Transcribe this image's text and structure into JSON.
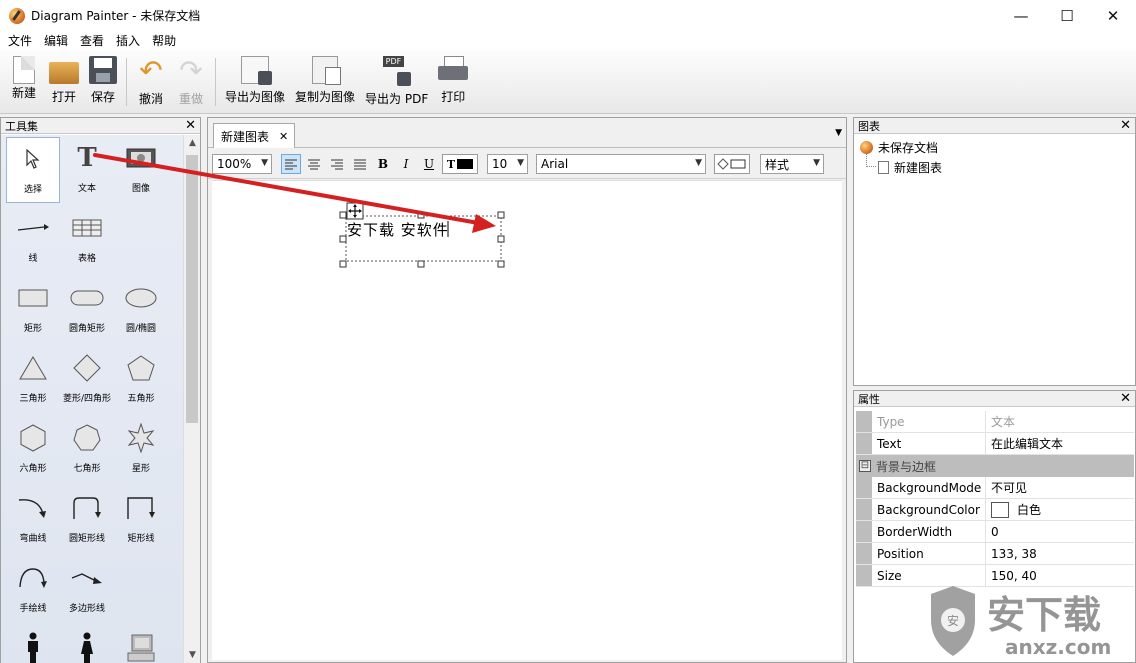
{
  "window": {
    "title": "Diagram Painter - 未保存文档",
    "controls": {
      "minimize": "—",
      "maximize": "☐",
      "close": "✕"
    }
  },
  "menu": [
    "文件",
    "编辑",
    "查看",
    "插入",
    "帮助"
  ],
  "toolbar": {
    "new": "新建",
    "open": "打开",
    "save": "保存",
    "undo": "撤消",
    "redo": "重做",
    "export_image": "导出为图像",
    "copy_image": "复制为图像",
    "export_pdf": "导出为 PDF",
    "pdf_badge": "PDF",
    "print": "打印"
  },
  "toolbox": {
    "title": "工具集",
    "tools": [
      {
        "label": "选择",
        "icon": "cursor-icon",
        "selected": true
      },
      {
        "label": "文本",
        "icon": "text-icon"
      },
      {
        "label": "图像",
        "icon": "image-icon"
      },
      {
        "label": "线",
        "icon": "line-icon"
      },
      {
        "label": "表格",
        "icon": "table-icon"
      },
      {
        "label": "矩形",
        "icon": "rectangle-icon"
      },
      {
        "label": "圆角矩形",
        "icon": "rounded-rectangle-icon"
      },
      {
        "label": "圆/椭圆",
        "icon": "ellipse-icon"
      },
      {
        "label": "三角形",
        "icon": "triangle-icon"
      },
      {
        "label": "菱形/四角形",
        "icon": "diamond-icon"
      },
      {
        "label": "五角形",
        "icon": "pentagon-icon"
      },
      {
        "label": "六角形",
        "icon": "hexagon-icon"
      },
      {
        "label": "七角形",
        "icon": "heptagon-icon"
      },
      {
        "label": "星形",
        "icon": "star-icon"
      },
      {
        "label": "弯曲线",
        "icon": "curved-line-icon"
      },
      {
        "label": "圆矩形线",
        "icon": "rounded-connector-icon"
      },
      {
        "label": "矩形线",
        "icon": "rect-connector-icon"
      },
      {
        "label": "手绘线",
        "icon": "freehand-icon"
      },
      {
        "label": "多边形线",
        "icon": "polyline-icon"
      }
    ]
  },
  "document": {
    "tab_label": "新建图表",
    "zoom": "100%",
    "font_size": "10",
    "font_name": "Arial",
    "style_label": "样式",
    "canvas_text": "安下载 安软件"
  },
  "chart_panel": {
    "title": "图表",
    "root": "未保存文档",
    "child": "新建图表"
  },
  "properties": {
    "title": "属性",
    "rows_top": [
      {
        "key": "Type",
        "value": "文本",
        "dim": true
      },
      {
        "key": "Text",
        "value": "在此编辑文本"
      }
    ],
    "group": "背景与边框",
    "group_toggle": "⊟",
    "rows": [
      {
        "key": "BackgroundMode",
        "value": "不可见"
      },
      {
        "key": "BackgroundColor",
        "value": "白色",
        "swatch": "#ffffff"
      },
      {
        "key": "BorderWidth",
        "value": "0"
      },
      {
        "key": "Position",
        "value": "133, 38"
      },
      {
        "key": "Size",
        "value": "150, 40"
      }
    ]
  },
  "watermark": {
    "text": "安下载",
    "url": "anxz.com"
  },
  "colors": {
    "arrow": "#d42020",
    "selection": "#cce4f7"
  }
}
